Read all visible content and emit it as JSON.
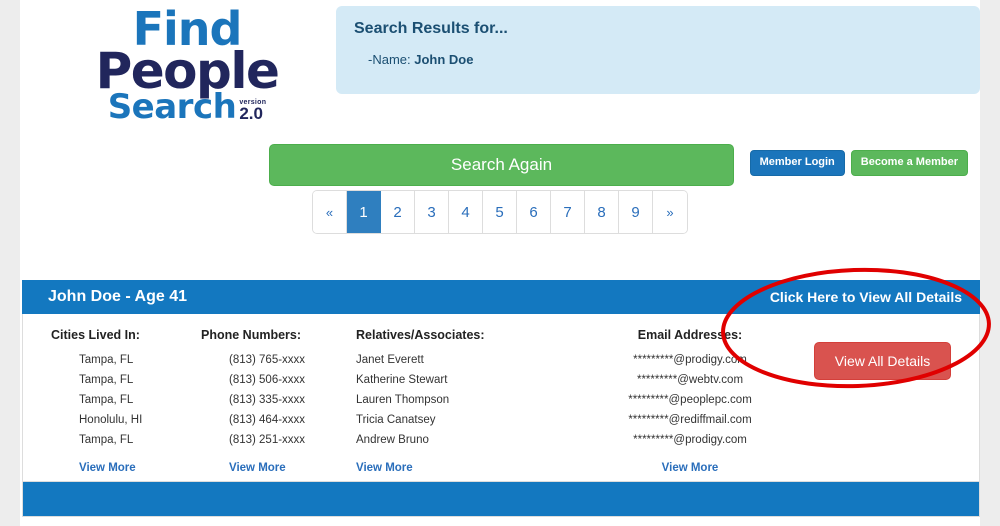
{
  "logo": {
    "line1": "Find",
    "line2": "People",
    "line3": "Search",
    "version_word": "version",
    "version_number": "2.0"
  },
  "search_results_panel": {
    "title": "Search Results for...",
    "criteria_prefix": "-Name:",
    "criteria_value": "John Doe"
  },
  "actions": {
    "search_again": "Search Again",
    "member_login": "Member Login",
    "become_member": "Become a Member"
  },
  "pagination": {
    "prev": "«",
    "next": "»",
    "pages": [
      "1",
      "2",
      "3",
      "4",
      "5",
      "6",
      "7",
      "8",
      "9"
    ],
    "active_page": "1"
  },
  "result_card": {
    "name": "John Doe - ",
    "age": " Age 41",
    "cta_header": "Click Here to View All Details",
    "view_all_button": "View All Details",
    "columns": [
      {
        "title": "Cities Lived In:",
        "values": [
          "Tampa, FL",
          "Tampa, FL",
          "Tampa, FL",
          "Honolulu, HI",
          "Tampa, FL"
        ],
        "view_more": "View More"
      },
      {
        "title": "Phone Numbers:",
        "values": [
          "(813) 765-xxxx",
          "(813) 506-xxxx",
          "(813) 335-xxxx",
          "(813) 464-xxxx",
          "(813) 251-xxxx"
        ],
        "view_more": "View More"
      },
      {
        "title": "Relatives/Associates:",
        "values": [
          "Janet Everett",
          "Katherine Stewart",
          "Lauren Thompson",
          "Tricia Canatsey",
          "Andrew Bruno"
        ],
        "view_more": "View More"
      },
      {
        "title": "Email Addresses:",
        "values": [
          "*********@prodigy.com",
          "*********@webtv.com",
          "*********@peoplepc.com",
          "*********@rediffmail.com",
          "*********@prodigy.com"
        ],
        "view_more": "View More"
      }
    ]
  },
  "colors": {
    "brand_blue": "#1378c0",
    "logo_light_blue": "#1b75bb",
    "logo_navy": "#21265c",
    "green": "#5cb85c",
    "red": "#d9534f",
    "link_blue": "#2a6ebb",
    "panel_blue": "#d4eaf6",
    "annotation_red": "#e00000",
    "page_background": "#ededed"
  }
}
